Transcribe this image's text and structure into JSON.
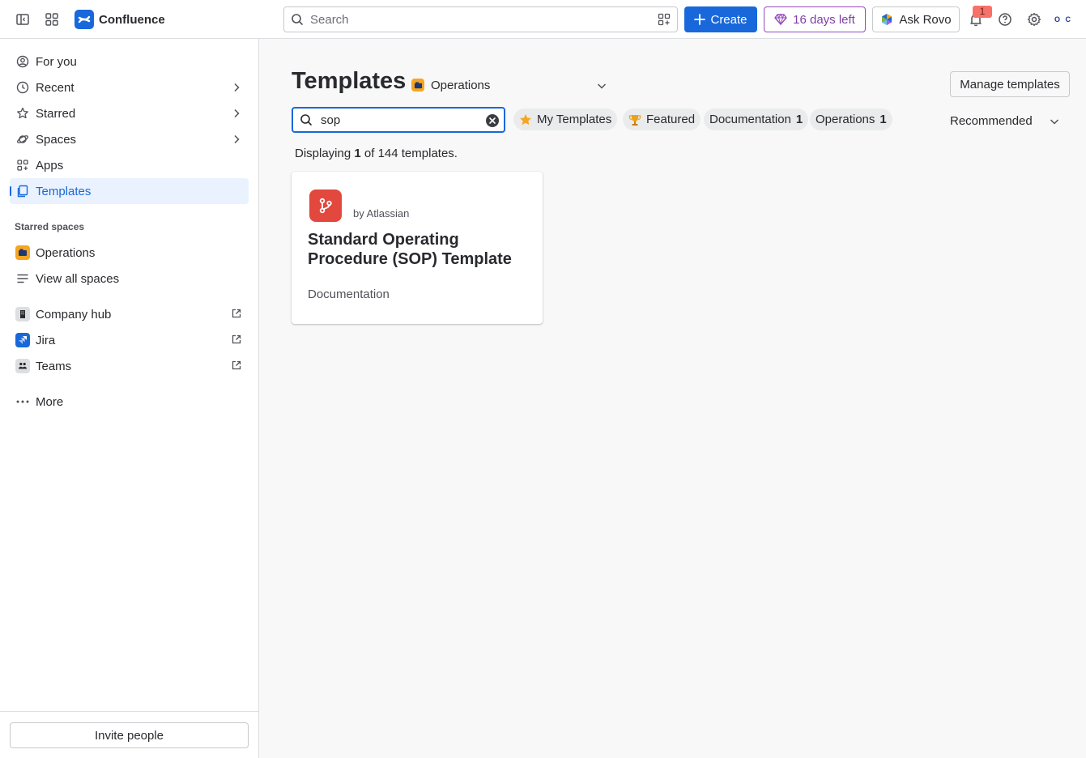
{
  "app": {
    "name": "Confluence",
    "search_placeholder": "Search",
    "create_label": "Create",
    "trial_label": "16 days left",
    "ask_rovo_label": "Ask Rovo",
    "notification_count": "1",
    "avatar_initials": "O C"
  },
  "colors": {
    "brand": "#1868DB",
    "trial": "#964AC0",
    "card_icon": "#E2483D",
    "space_icon": "#F5A623"
  },
  "sidebar": {
    "items": [
      {
        "label": "For you",
        "icon": "person-circle-icon"
      },
      {
        "label": "Recent",
        "icon": "clock-icon"
      },
      {
        "label": "Starred",
        "icon": "star-icon"
      },
      {
        "label": "Spaces",
        "icon": "planet-icon"
      },
      {
        "label": "Apps",
        "icon": "apps-icon"
      },
      {
        "label": "Templates",
        "icon": "templates-icon"
      }
    ],
    "starred_spaces_label": "Starred spaces",
    "starred_spaces": [
      {
        "label": "Operations"
      },
      {
        "label": "View all spaces"
      }
    ],
    "links": [
      {
        "label": "Company hub"
      },
      {
        "label": "Jira"
      },
      {
        "label": "Teams"
      }
    ],
    "more_label": "More",
    "invite_label": "Invite people"
  },
  "main": {
    "title": "Templates",
    "space_filter": "Operations",
    "manage_label": "Manage templates",
    "search_value": "sop",
    "chips": [
      {
        "label": "My Templates",
        "icon": "star-filled-icon"
      },
      {
        "label": "Featured",
        "icon": "trophy-icon"
      },
      {
        "label": "Documentation",
        "count": "1"
      },
      {
        "label": "Operations",
        "count": "1"
      }
    ],
    "sort_label": "Recommended",
    "displaying": {
      "prefix": "Displaying",
      "shown": "1",
      "middle": "of 144 templates."
    },
    "cards": [
      {
        "by": "by Atlassian",
        "title": "Standard Operating Procedure (SOP) Template",
        "category": "Documentation",
        "icon": "branch-icon"
      }
    ]
  }
}
